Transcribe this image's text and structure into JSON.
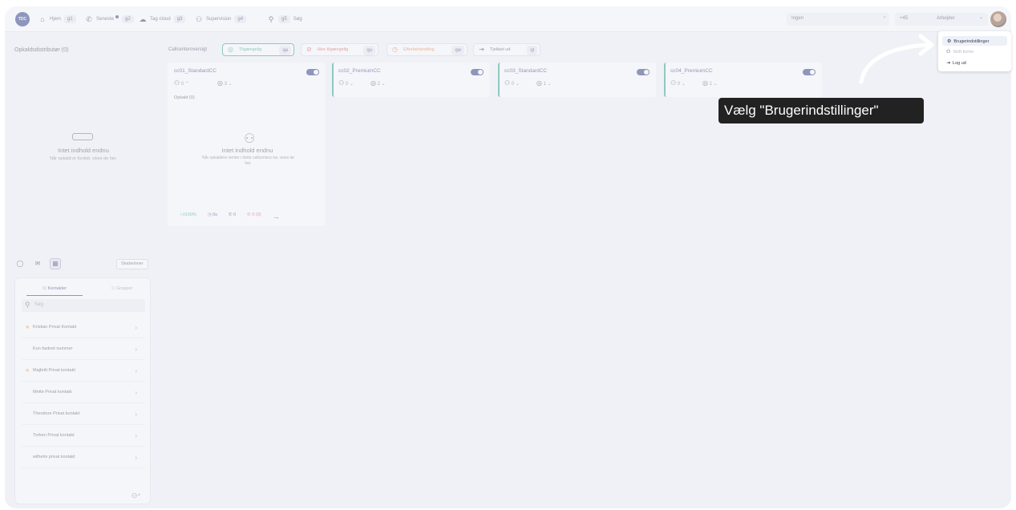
{
  "topbar": {
    "logo": "TDC",
    "nav": [
      {
        "icon": "home-icon",
        "glyph": "⌂",
        "label": "Hjem",
        "key": "g1"
      },
      {
        "icon": "phone-icon",
        "glyph": "✆",
        "label": "Seneste",
        "key": "g2"
      },
      {
        "icon": "cloud-icon",
        "glyph": "☁",
        "label": "Tag cloud",
        "key": "g3"
      },
      {
        "icon": "supervision-icon",
        "glyph": "⚇",
        "label": "Supervision",
        "key": "g4"
      },
      {
        "icon": "search-icon",
        "glyph": "⚲",
        "label": "Søg",
        "key": "g5"
      }
    ],
    "queue_select": "Ingen",
    "phone_prefix": "+45",
    "work_status": "Arbejder"
  },
  "left": {
    "title": "Opkaldsdistributør (0)",
    "empty_title": "Intet indhold endnu",
    "empty_sub": "Når opkald er fordelt, vises de her.",
    "templates_button": "Skabeloner"
  },
  "contacts": {
    "tab_contacts": "Kontakter",
    "tab_groups": "Grupper",
    "search_placeholder": "Søg",
    "items": [
      {
        "name": "Kristian Privat Kontakt",
        "favorite": true
      },
      {
        "name": "Kun fastnet nummer",
        "favorite": false
      },
      {
        "name": "Majbritt Privat kontakt",
        "favorite": true
      },
      {
        "name": "Mette Privat kontakt",
        "favorite": false
      },
      {
        "name": "Theodore Privat kontakt",
        "favorite": false
      },
      {
        "name": "Torben Privat kontakt",
        "favorite": false
      },
      {
        "name": "wilhelm privat kontakt",
        "favorite": false
      }
    ]
  },
  "callcenter": {
    "overview_label": "Callcenteroversigt",
    "statuses": [
      {
        "label": "Tilgængelig",
        "key": "qa"
      },
      {
        "label": "Ikke tilgængelig",
        "key": "qu"
      },
      {
        "label": "Efterbehandling",
        "key": "qw"
      },
      {
        "label": "Tjekket ud",
        "key": "ql"
      }
    ],
    "cards": [
      {
        "name": "cc01_StandardCC",
        "agents": "0",
        "queue": "3"
      },
      {
        "name": "cc02_PremiumCC",
        "agents": "0",
        "queue": "2"
      },
      {
        "name": "cc03_StandardCC",
        "agents": "0",
        "queue": "1"
      },
      {
        "name": "cc04_PremiumCC",
        "agents": "0",
        "queue": "1"
      }
    ],
    "calls_label": "Opkald (0)",
    "card_empty_title": "Intet indhold endnu",
    "card_empty_sub": "Når opkaldere venter i dette callcenters kø, vises de her.",
    "footer": {
      "answer_rate": "100%",
      "wait": "0s",
      "calls": "0",
      "missed": "0 (0)"
    }
  },
  "user_menu": {
    "items": [
      {
        "label": "Brugerindstillinger",
        "icon": "gear-icon"
      },
      {
        "label": "Skift konto",
        "icon": "switch-user-icon"
      },
      {
        "label": "Log ud",
        "icon": "logout-icon"
      }
    ]
  },
  "tooltip": "Vælg \"Brugerindstillinger\""
}
